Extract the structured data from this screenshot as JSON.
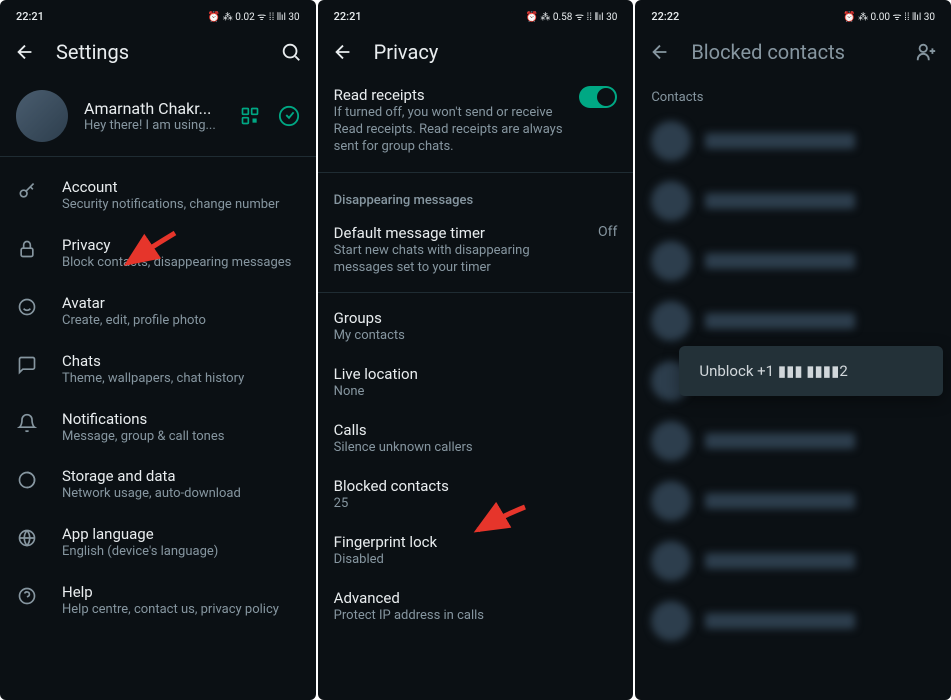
{
  "screen1": {
    "time": "22:21",
    "status_icons": "⏰ ⁂ 0.02 ᯤ ⁞⁞ ⫴ıl 30",
    "title": "Settings",
    "profile": {
      "name": "Amarnath Chakr...",
      "status": "Hey there! I am using..."
    },
    "items": [
      {
        "title": "Account",
        "subtitle": "Security notifications, change number"
      },
      {
        "title": "Privacy",
        "subtitle": "Block contacts, disappearing messages"
      },
      {
        "title": "Avatar",
        "subtitle": "Create, edit, profile photo"
      },
      {
        "title": "Chats",
        "subtitle": "Theme, wallpapers, chat history"
      },
      {
        "title": "Notifications",
        "subtitle": "Message, group & call tones"
      },
      {
        "title": "Storage and data",
        "subtitle": "Network usage, auto-download"
      },
      {
        "title": "App language",
        "subtitle": "English (device's language)"
      },
      {
        "title": "Help",
        "subtitle": "Help centre, contact us, privacy policy"
      }
    ]
  },
  "screen2": {
    "time": "22:21",
    "status_icons": "⏰ ⁂ 0.58 ᯤ ⁞⁞ ⫴ıl 30",
    "title": "Privacy",
    "read_receipts": {
      "title": "Read receipts",
      "desc": "If turned off, you won't send or receive Read receipts. Read receipts are always sent for group chats."
    },
    "section_disappearing": "Disappearing messages",
    "default_timer": {
      "title": "Default message timer",
      "desc": "Start new chats with disappearing messages set to your timer",
      "value": "Off"
    },
    "groups": {
      "title": "Groups",
      "sub": "My contacts"
    },
    "live_location": {
      "title": "Live location",
      "sub": "None"
    },
    "calls": {
      "title": "Calls",
      "sub": "Silence unknown callers"
    },
    "blocked": {
      "title": "Blocked contacts",
      "sub": "25"
    },
    "fingerprint": {
      "title": "Fingerprint lock",
      "sub": "Disabled"
    },
    "advanced": {
      "title": "Advanced",
      "sub": "Protect IP address in calls"
    }
  },
  "screen3": {
    "time": "22:22",
    "status_icons": "⏰ ⁂ 0.00 ᯤ ⁞⁞ ⫴ıl 30",
    "title": "Blocked contacts",
    "contacts_header": "Contacts",
    "popup": "Unblock +1 ▮▮▮ ▮▮▮▮2"
  }
}
